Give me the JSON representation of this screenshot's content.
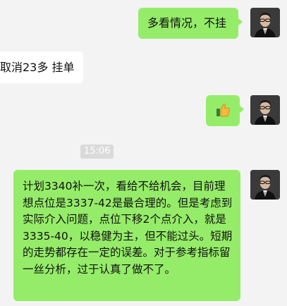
{
  "messages": {
    "m1_text": "多看情况，不挂",
    "m2_text": "取消23多 挂单",
    "m3_emoji": "👍",
    "timestamp": "15:06",
    "m4_text": "计划3340补一次，看给不给机会，目前理想点位是3337-42是最合理的。但是考虑到实际介入问题，点位下移2个点介入，就是3335-40，以稳健为主，但不能过头。短期的走势都存在一定的误差。对于参考指标留一丝分析，过于认真了做不了。"
  },
  "colors": {
    "background": "#f3f3f3",
    "outgoing_bubble": "#95ec69",
    "incoming_bubble": "#ffffff",
    "timestamp_bg": "#dadada"
  },
  "icons": {
    "thumbs_up": "thumbs-up-icon",
    "avatar": "avatar"
  }
}
